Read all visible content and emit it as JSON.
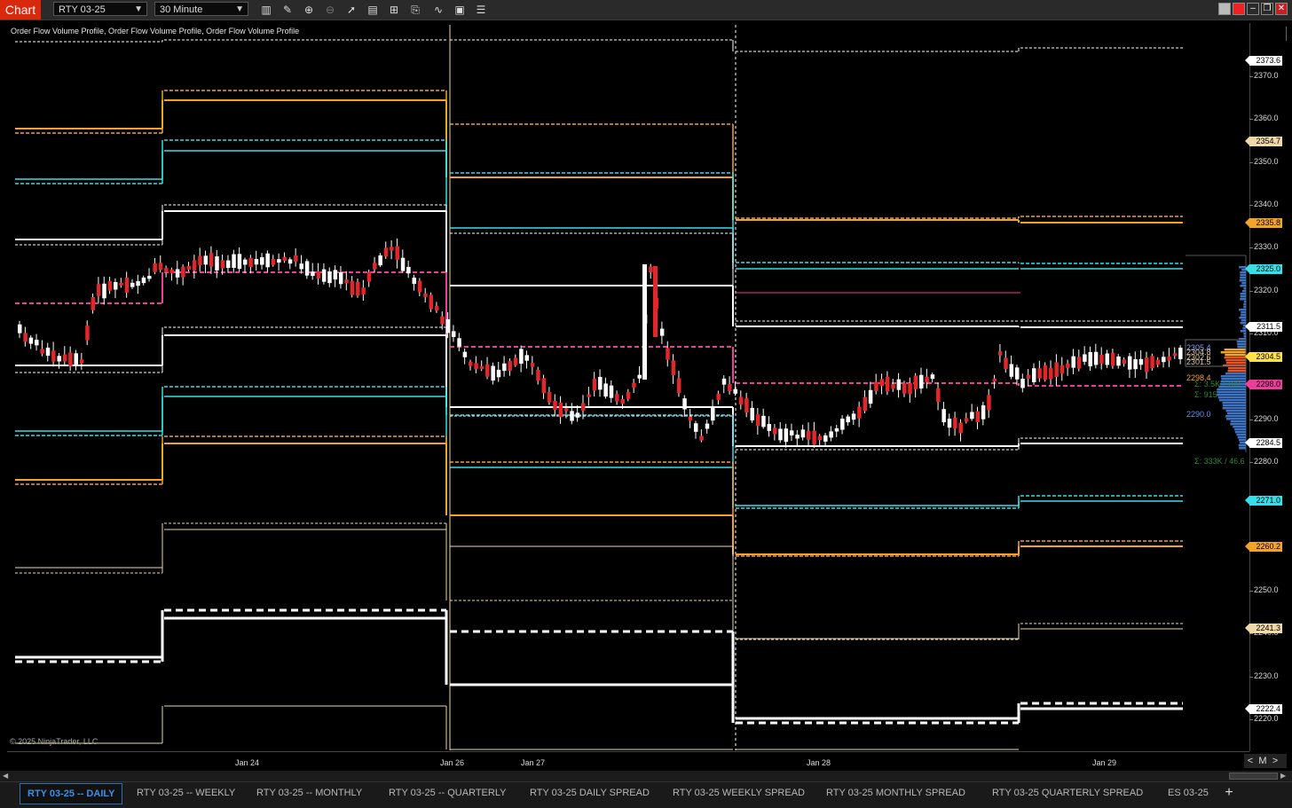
{
  "titlebar": {
    "app_badge": "Chart",
    "instrument": "RTY 03-25",
    "timeframe": "30 Minute",
    "tools": [
      "bar-type-icon",
      "draw-pencil-icon",
      "zoom-in-icon",
      "zoom-out-icon",
      "pointer-icon",
      "data-box-icon",
      "templates-icon",
      "strategies-icon",
      "indicators-icon",
      "properties-icon",
      "list-icon"
    ]
  },
  "indicator_label": "Order Flow Volume Profile, Order Flow Volume Profile, Order Flow Volume Profile",
  "copyright": "© 2025 NinjaTrader, LLC",
  "f_button": "F",
  "y_axis": {
    "ticks": [
      "2370.0",
      "2360.0",
      "2350.0",
      "2340.0",
      "2330.0",
      "2320.0",
      "2310.0",
      "2290.0",
      "2280.0",
      "2250.0",
      "2240.0",
      "2230.0",
      "2220.0"
    ],
    "price_tags": [
      {
        "value": "2373.6",
        "color": "#ffffff"
      },
      {
        "value": "2354.7",
        "color": "#f0d9a8"
      },
      {
        "value": "2335.8",
        "color": "#f4a329"
      },
      {
        "value": "2325.0",
        "color": "#35e0e8"
      },
      {
        "value": "2311.5",
        "color": "#ffffff"
      },
      {
        "value": "2304.5",
        "color": "#ffe14a"
      },
      {
        "value": "2298.0",
        "color": "#ee3d9a"
      },
      {
        "value": "2284.5",
        "color": "#ffffff"
      },
      {
        "value": "2271.0",
        "color": "#35e0e8"
      },
      {
        "value": "2260.2",
        "color": "#f4a329"
      },
      {
        "value": "2241.3",
        "color": "#f0d9a8"
      },
      {
        "value": "2222.4",
        "color": "#ffffff"
      }
    ]
  },
  "volume_profile_labels": [
    {
      "text": "2305.4",
      "color": "#8aa2ff"
    },
    {
      "text": "2304.8",
      "color": "#d8c6a6"
    },
    {
      "text": "2302.6",
      "color": "#d8c6a6"
    },
    {
      "text": "2301.5",
      "color": "#d8c6a6"
    },
    {
      "text": "2298.4",
      "color": "#f4a329"
    },
    {
      "text": "Σ: 3.5K / 100",
      "color": "#2e8b2e"
    },
    {
      "text": "Σ: 915",
      "color": "#2e8b2e"
    },
    {
      "text": "2290.0",
      "color": "#6f8fe8"
    },
    {
      "text": "Σ: 333K / 46.6",
      "color": "#2e8b2e"
    }
  ],
  "x_axis": {
    "labels": [
      "Jan 24",
      "Jan 26",
      "Jan 27",
      "Jan 28",
      "Jan 29"
    ]
  },
  "controls": {
    "prev": "<",
    "mode": "M",
    "next": ">"
  },
  "tabs": [
    {
      "label": "RTY 03-25 -- DAILY",
      "active": true
    },
    {
      "label": "RTY 03-25 -- WEEKLY",
      "active": false
    },
    {
      "label": "RTY 03-25 -- MONTHLY",
      "active": false
    },
    {
      "label": "RTY 03-25 -- QUARTERLY",
      "active": false
    },
    {
      "label": "RTY 03-25 DAILY SPREAD",
      "active": false
    },
    {
      "label": "RTY 03-25 WEEKLY SPREAD",
      "active": false
    },
    {
      "label": "RTY 03-25 MONTHLY SPREAD",
      "active": false
    },
    {
      "label": "RTY 03-25 QUARTERLY SPREAD",
      "active": false
    },
    {
      "label": "ES 03-25",
      "active": false
    }
  ],
  "colors": {
    "up_candle": "#ffffff",
    "down_candle": "#e3262a",
    "level_white": "#ffffff",
    "level_orange": "#f4a329",
    "level_cyan": "#35e0e8",
    "level_magenta": "#ee3d9a",
    "level_tan": "#f0d9a8"
  }
}
